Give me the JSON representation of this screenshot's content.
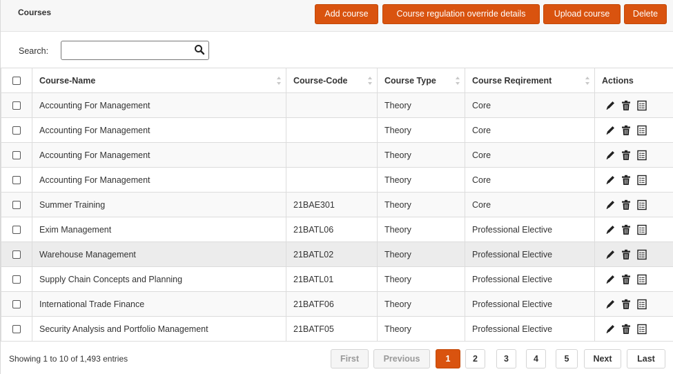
{
  "header": {
    "title": "Courses",
    "buttons": {
      "add": "Add course",
      "override": "Course regulation override details",
      "upload": "Upload course",
      "delete": "Delete"
    }
  },
  "search": {
    "label": "Search:",
    "value": "",
    "placeholder": ""
  },
  "table": {
    "columns": {
      "name": "Course-Name",
      "code": "Course-Code",
      "type": "Course Type",
      "requirement": "Course Reqirement",
      "actions": "Actions"
    },
    "rows": [
      {
        "name": "Accounting For Management",
        "code": "",
        "type": "Theory",
        "requirement": "Core"
      },
      {
        "name": "Accounting For Management",
        "code": "",
        "type": "Theory",
        "requirement": "Core"
      },
      {
        "name": "Accounting For Management",
        "code": "",
        "type": "Theory",
        "requirement": "Core"
      },
      {
        "name": "Accounting For Management",
        "code": "",
        "type": "Theory",
        "requirement": "Core"
      },
      {
        "name": "Summer Training",
        "code": "21BAE301",
        "type": "Theory",
        "requirement": "Core"
      },
      {
        "name": "Exim Management",
        "code": "21BATL06",
        "type": "Theory",
        "requirement": "Professional Elective"
      },
      {
        "name": "Warehouse Management",
        "code": "21BATL02",
        "type": "Theory",
        "requirement": "Professional Elective"
      },
      {
        "name": "Supply Chain Concepts and Planning",
        "code": "21BATL01",
        "type": "Theory",
        "requirement": "Professional Elective"
      },
      {
        "name": "International Trade Finance",
        "code": "21BATF06",
        "type": "Theory",
        "requirement": "Professional Elective"
      },
      {
        "name": "Security Analysis and Portfolio Management",
        "code": "21BATF05",
        "type": "Theory",
        "requirement": "Professional Elective"
      }
    ],
    "action_icons": [
      "pencil-icon",
      "trash-icon",
      "details-icon"
    ]
  },
  "footer": {
    "info": "Showing 1 to 10 of 1,493 entries",
    "pagination": {
      "first": "First",
      "previous": "Previous",
      "pages": [
        "1",
        "2",
        "3",
        "4",
        "5"
      ],
      "current": "1",
      "next": "Next",
      "last": "Last"
    }
  },
  "colors": {
    "accent": "#d9530f",
    "header_bg": "#f7f7f7",
    "stripe": "#f9f9f9",
    "hover": "#ececec"
  }
}
